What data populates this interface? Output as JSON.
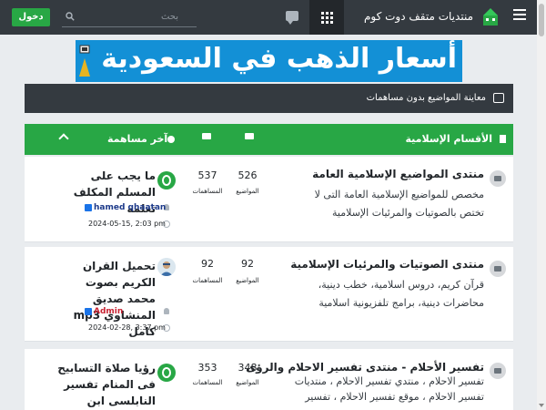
{
  "navbar": {
    "site_title": "منتديات متقف دوت كوم",
    "search_placeholder": "بحث",
    "login_label": "دخول"
  },
  "banner": {
    "text": "أسعار الذهب في السعودية"
  },
  "notice": {
    "text": "معاينة المواضيع بدون مساهمات"
  },
  "category": {
    "title": "الأقسام الإسلامية",
    "last_post_header": "آخر مساهمة"
  },
  "forums": [
    {
      "title": "منتدى المواضيع الإسلامية العامة",
      "description": "مخصص للمواضيع الإسلامية العامة التى لا تختص بالصوتيات والمرئيات الإسلامية",
      "topics": "526",
      "topics_label": "المواضيع",
      "posts": "537",
      "posts_label": "المساهمات",
      "last_post_title": "ما يجب على المسلم المكلف تعلمه",
      "last_post_user": "hamed qhaatan",
      "last_post_date": "2024-05-15, 2:03 pm"
    },
    {
      "title": "منتدى الصوتيات والمرئيات الإسلامية",
      "description": "قرآن كريم، دروس اسلامية، خطب دينية، محاضرات دينية، برامج تلفزيونية اسلامية",
      "topics": "92",
      "topics_label": "المواضيع",
      "posts": "92",
      "posts_label": "المساهمات",
      "last_post_title": "تحميل القران الكريم بصوت محمد صديق المنشاوي mp3 كامل",
      "last_post_user": "Admin",
      "last_post_date": "2024-02-28, 3:37 pm"
    },
    {
      "title": "تفسير الأحلام - منتدى تفسير الاحلام والرؤى",
      "description": "تفسير الاحلام ، منتدي تفسير الاحلام ، منتديات تفسير الاحلام ، موقع تفسير الاحلام ، تفسير",
      "topics": "348",
      "topics_label": "المواضيع",
      "posts": "353",
      "posts_label": "المساهمات",
      "last_post_title": "رؤيا صلاة التسابيح فى المنام تفسير النابلسى ابن سيرين ابن شاهين"
    }
  ],
  "colors": {
    "navbar": "#343a40",
    "accent_green": "#28a745",
    "banner_blue": "#1390d6",
    "user_blue": "#1d3a8a",
    "admin_red": "#c82333"
  }
}
